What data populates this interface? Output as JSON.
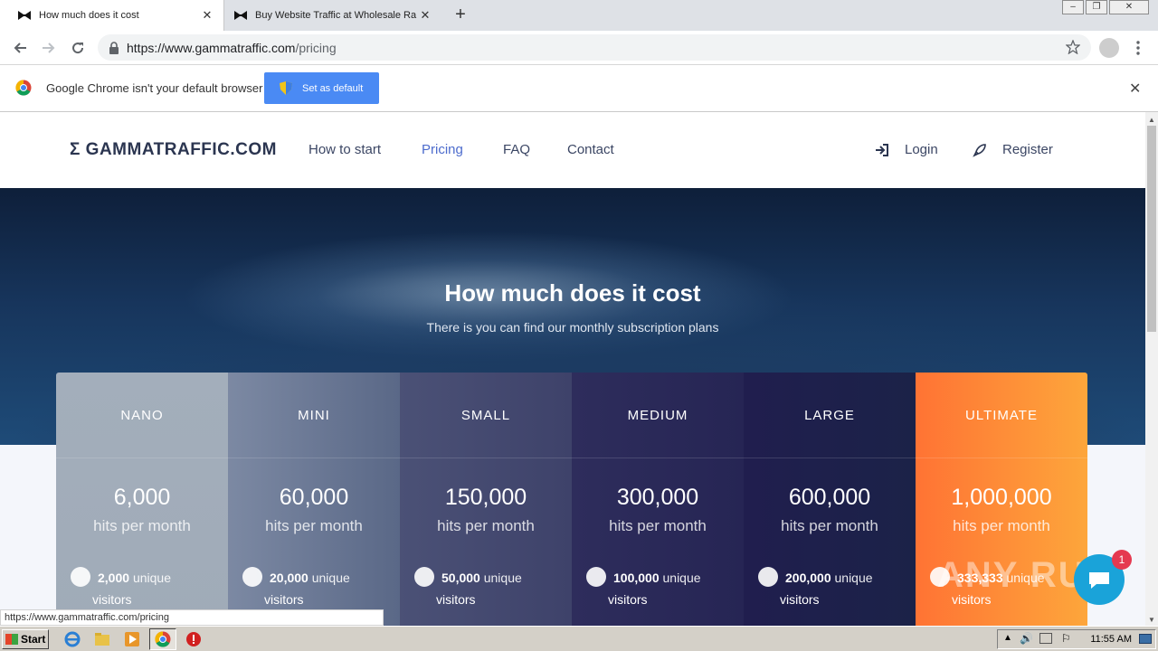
{
  "browser": {
    "tabs": [
      {
        "title": "How much does it cost",
        "active": true
      },
      {
        "title": "Buy Website Traffic at Wholesale Ra",
        "active": false
      }
    ],
    "url_host": "https://www.gammatraffic.com",
    "url_path": "/pricing",
    "infobar": {
      "message": "Google Chrome isn't your default browser",
      "button": "Set as default"
    },
    "status_url": "https://www.gammatraffic.com/pricing"
  },
  "site": {
    "brand": "Σ GAMMATRAFFIC.COM",
    "nav": [
      {
        "label": "How to start",
        "active": false
      },
      {
        "label": "Pricing",
        "active": true
      },
      {
        "label": "FAQ",
        "active": false
      },
      {
        "label": "Contact",
        "active": false
      }
    ],
    "login": "Login",
    "register": "Register",
    "hero": {
      "title": "How much does it cost",
      "subtitle": "There is you can find our monthly subscription plans"
    },
    "hits_unit": "hits per month",
    "visitors_label_1": "unique",
    "visitors_label_2": "visitors",
    "plans": [
      {
        "name": "NANO",
        "hits": "6,000",
        "unique": "2,000"
      },
      {
        "name": "MINI",
        "hits": "60,000",
        "unique": "20,000"
      },
      {
        "name": "SMALL",
        "hits": "150,000",
        "unique": "50,000"
      },
      {
        "name": "MEDIUM",
        "hits": "300,000",
        "unique": "100,000"
      },
      {
        "name": "LARGE",
        "hits": "600,000",
        "unique": "200,000"
      },
      {
        "name": "ULTIMATE",
        "hits": "1,000,000",
        "unique": "333,333"
      }
    ],
    "chat_badge": "1",
    "watermark": "ANY RUN"
  },
  "taskbar": {
    "start": "Start",
    "time": "11:55 AM"
  }
}
